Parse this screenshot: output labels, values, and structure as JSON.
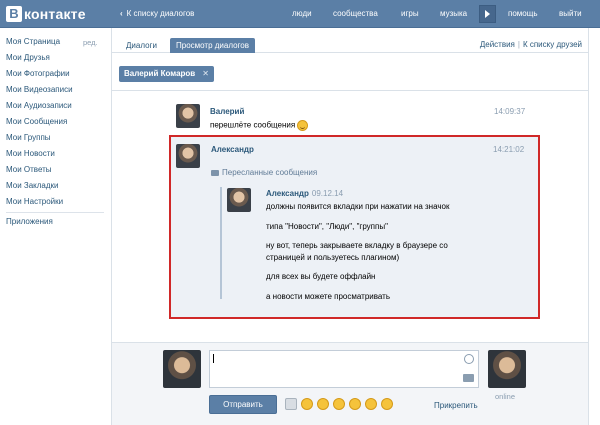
{
  "header": {
    "logo_letter": "B",
    "logo_text": "контакте",
    "back_label": "К списку диалогов",
    "nav": [
      "люди",
      "сообщества",
      "игры",
      "музыка",
      "помощь",
      "выйти"
    ]
  },
  "sidebar": {
    "items": [
      "Моя Страница",
      "Мои Друзья",
      "Мои Фотографии",
      "Мои Видеозаписи",
      "Мои Аудиозаписи",
      "Мои Сообщения",
      "Мои Группы",
      "Мои Новости",
      "Мои Ответы",
      "Мои Закладки",
      "Мои Настройки"
    ],
    "edit_label": "ред.",
    "apps_label": "Приложения"
  },
  "tabs": {
    "items": [
      "Диалоги",
      "Просмотр диалогов"
    ],
    "active_index": 1,
    "actions_label": "Действия",
    "to_friends_label": "К списку друзей"
  },
  "contact_tag": "Валерий Комаров",
  "messages": [
    {
      "author": "Валерий",
      "time": "14:09:37",
      "text": "перешлёте сообщения"
    },
    {
      "author": "Александр",
      "time": "14:21:02"
    }
  ],
  "forwarded": {
    "label": "Пересланные сообщения",
    "author": "Александр",
    "date": "09.12.14",
    "lines": [
      "должны появится вкладки при нажатии на значок",
      "типа \"Новости\", \"Люди\", \"группы\"",
      "ну вот, теперь закрываете вкладку в браузере со",
      "страницей и пользуетесь плагином)",
      "для всех вы будете оффлайн",
      "а новости можете просматривать"
    ]
  },
  "composer": {
    "value": "",
    "send_label": "Отправить",
    "attach_label": "Прикрепить",
    "status_label": "online"
  },
  "colors": {
    "brand": "#5b7fa6",
    "link": "#2b587a",
    "highlight_border": "#d02828",
    "selected_message_bg": "#edf1f6"
  }
}
